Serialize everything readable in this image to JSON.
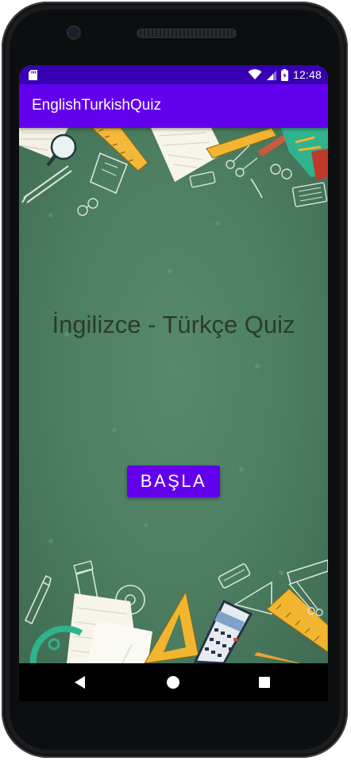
{
  "status_bar": {
    "time": "12:48",
    "icons": [
      "sd-card-icon",
      "wifi-icon",
      "signal-icon",
      "battery-icon"
    ]
  },
  "app_bar": {
    "title": "EnglishTurkishQuiz"
  },
  "main": {
    "title": "İngilizce - Türkçe Quiz",
    "start_button_label": "BAŞLA"
  },
  "nav_bar": {
    "icons": [
      "back-icon",
      "home-icon",
      "recents-icon"
    ]
  },
  "colors": {
    "status_bar": "#3700b3",
    "app_bar": "#6200ee",
    "button": "#6200ee",
    "chalkboard": "#4a7a5e",
    "title_text": "#2c3a30"
  }
}
